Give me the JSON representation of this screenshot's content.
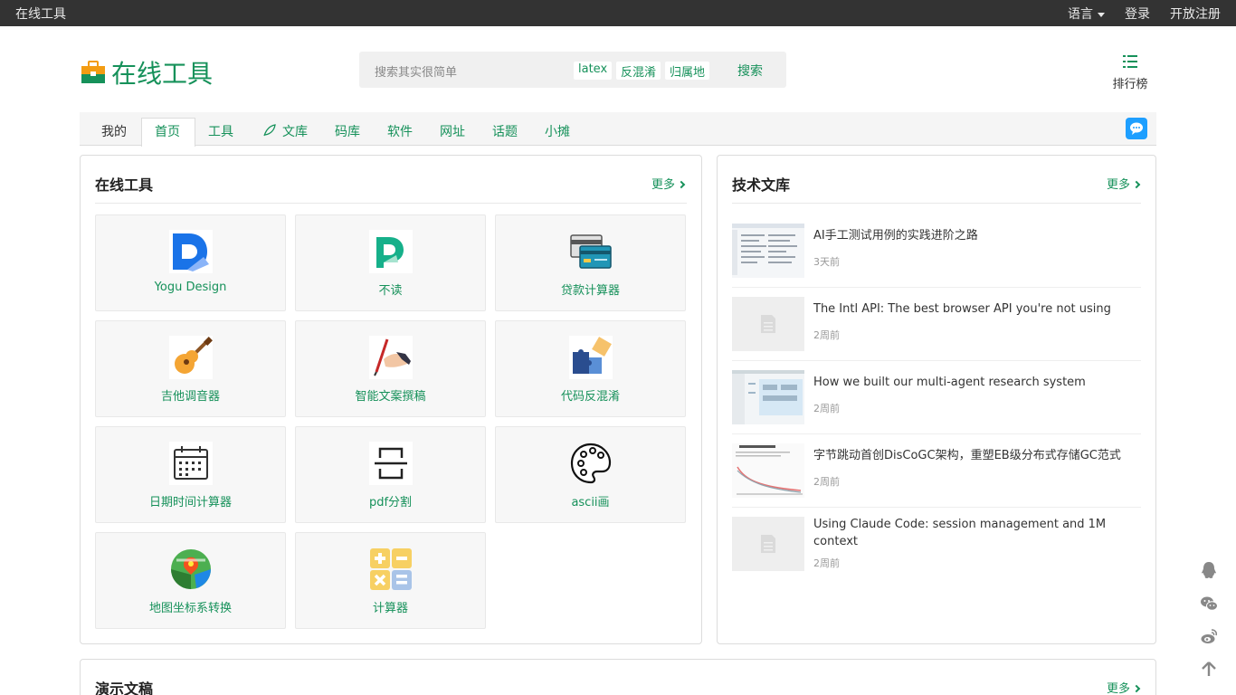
{
  "topbar": {
    "site_name": "在线工具",
    "language": "语言",
    "login": "登录",
    "register": "开放注册"
  },
  "header": {
    "logo_text": "在线工具",
    "search_placeholder": "搜索其实很简单",
    "tags": [
      "latex",
      "反混淆",
      "归属地"
    ],
    "search_button": "搜索",
    "ranking": "排行榜"
  },
  "nav": {
    "items": [
      "我的",
      "首页",
      "工具",
      "文库",
      "码库",
      "软件",
      "网址",
      "话题",
      "小摊"
    ],
    "active": "首页"
  },
  "tools_panel": {
    "title": "在线工具",
    "more": "更多",
    "tools": [
      {
        "label": "Yogu Design",
        "icon": "yogu-design-icon"
      },
      {
        "label": "不读",
        "icon": "budu-icon"
      },
      {
        "label": "贷款计算器",
        "icon": "credit-card-icon"
      },
      {
        "label": "吉他调音器",
        "icon": "guitar-icon"
      },
      {
        "label": "智能文案撰稿",
        "icon": "pen-hand-icon"
      },
      {
        "label": "代码反混淆",
        "icon": "puzzle-icon"
      },
      {
        "label": "日期时间计算器",
        "icon": "calendar-icon"
      },
      {
        "label": "pdf分割",
        "icon": "split-icon"
      },
      {
        "label": "ascii画",
        "icon": "palette-icon"
      },
      {
        "label": "地图坐标系转换",
        "icon": "map-pin-icon"
      },
      {
        "label": "计算器",
        "icon": "calculator-icon"
      }
    ]
  },
  "library_panel": {
    "title": "技术文库",
    "more": "更多",
    "articles": [
      {
        "title": "AI手工测试用例的实践进阶之路",
        "time": "3天前"
      },
      {
        "title": "The Intl API: The best browser API you're not using",
        "time": "2周前"
      },
      {
        "title": "How we built our multi-agent research system",
        "time": "2周前"
      },
      {
        "title": "字节跳动首创DisCoGC架构，重塑EB级分布式存储GC范式",
        "time": "2周前"
      },
      {
        "title": "Using Claude Code: session management and 1M context",
        "time": "2周前"
      }
    ]
  },
  "slides_panel": {
    "title": "演示文稿",
    "more": "更多"
  },
  "floating": [
    "qq-icon",
    "wechat-icon",
    "weibo-icon",
    "back-to-top-icon"
  ],
  "colors": {
    "accent": "#16915a",
    "topbar": "#333333",
    "chat": "#1e9fff"
  }
}
